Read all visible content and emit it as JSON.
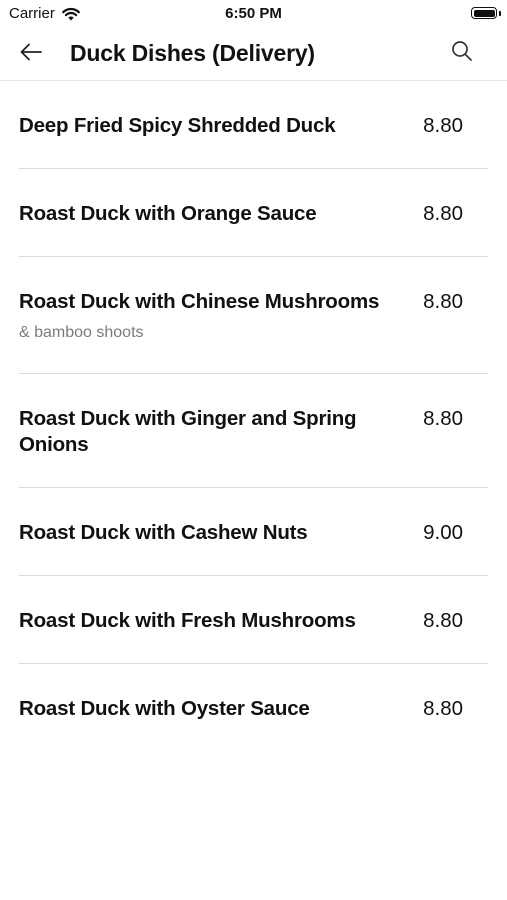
{
  "status_bar": {
    "carrier": "Carrier",
    "time": "6:50 PM"
  },
  "nav": {
    "title": "Duck Dishes (Delivery)",
    "back_icon": "arrow-left-icon",
    "search_icon": "search-icon"
  },
  "menu": {
    "items": [
      {
        "name": "Deep Fried Spicy Shredded Duck",
        "description": "",
        "price": "8.80"
      },
      {
        "name": "Roast Duck with Orange Sauce",
        "description": "",
        "price": "8.80"
      },
      {
        "name": "Roast Duck with Chinese Mushrooms",
        "description": "& bamboo shoots",
        "price": "8.80"
      },
      {
        "name": "Roast Duck with Ginger and Spring Onions",
        "description": "",
        "price": "8.80"
      },
      {
        "name": "Roast Duck with Cashew Nuts",
        "description": "",
        "price": "9.00"
      },
      {
        "name": "Roast Duck with Fresh Mushrooms",
        "description": "",
        "price": "8.80"
      },
      {
        "name": "Roast Duck with Oyster Sauce",
        "description": "",
        "price": "8.80"
      }
    ]
  }
}
